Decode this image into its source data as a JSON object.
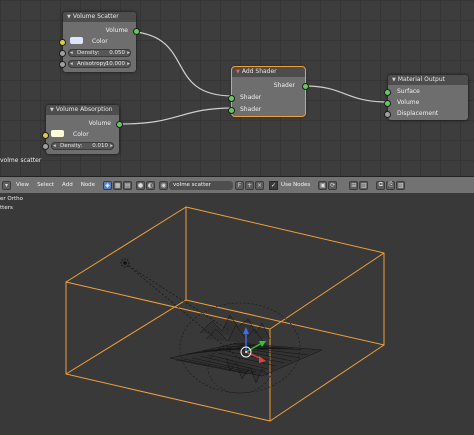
{
  "node_editor": {
    "nodes": {
      "volume_scatter": {
        "title": "Volume Scatter",
        "output_label": "Volume",
        "color_label": "Color",
        "color_value": "#dde6ff",
        "density_label": "Density:",
        "density_value": "0.050",
        "anisotropy_label": "Anisotropy:",
        "anisotropy_value": "10.000"
      },
      "volume_absorption": {
        "title": "Volume Absorption",
        "output_label": "Volume",
        "color_label": "Color",
        "color_value": "#fffbd8",
        "density_label": "Density:",
        "density_value": "0.010"
      },
      "add_shader": {
        "title": "Add Shader",
        "output_label": "Shader",
        "input1_label": "Shader",
        "input2_label": "Shader"
      },
      "material_output": {
        "title": "Material Output",
        "surface_label": "Surface",
        "volume_label": "Volume",
        "displacement_label": "Displacement"
      }
    },
    "material_label": "volme scatter"
  },
  "header": {
    "menus": [
      "View",
      "Select",
      "Add",
      "Node"
    ],
    "material_name": "volme scatter",
    "use_nodes_label": "Use Nodes",
    "use_nodes_checked": true
  },
  "viewport": {
    "view_mode": "er Ortho",
    "sub_label": "tters"
  },
  "colors": {
    "accent_orange": "#f0a03a",
    "socket_green": "#62c860",
    "socket_yellow": "#d8d040"
  }
}
